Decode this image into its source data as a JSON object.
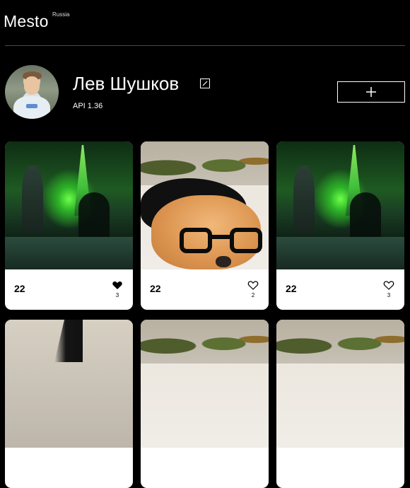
{
  "header": {
    "logo": "Mesto",
    "logo_sup": "Russia"
  },
  "profile": {
    "name": "Лев Шушков",
    "about": "API 1.36"
  },
  "cards": [
    {
      "title": "22",
      "likes": "3",
      "liked": true
    },
    {
      "title": "22",
      "likes": "2",
      "liked": false
    },
    {
      "title": "22",
      "likes": "3",
      "liked": false
    }
  ]
}
